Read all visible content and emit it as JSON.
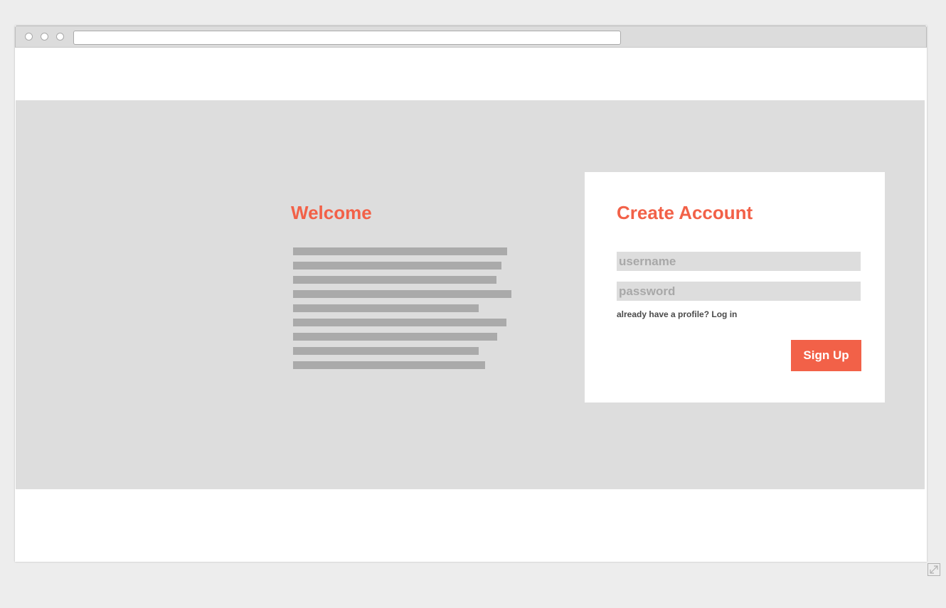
{
  "browser": {
    "window_controls": [
      "circle",
      "circle",
      "circle"
    ],
    "address": ""
  },
  "welcome": {
    "title": "Welcome",
    "placeholder_lines": 9
  },
  "signup": {
    "title": "Create Account",
    "username_placeholder": "username",
    "password_placeholder": "password",
    "login_hint": "already have a profile? Log in",
    "button_label": "Sign Up"
  },
  "icons": {
    "resize": "expand-icon"
  },
  "colors": {
    "accent": "#f26148",
    "hero_background": "#dddddd",
    "page_background": "#ededed",
    "placeholder_line": "#aaaaaa"
  }
}
